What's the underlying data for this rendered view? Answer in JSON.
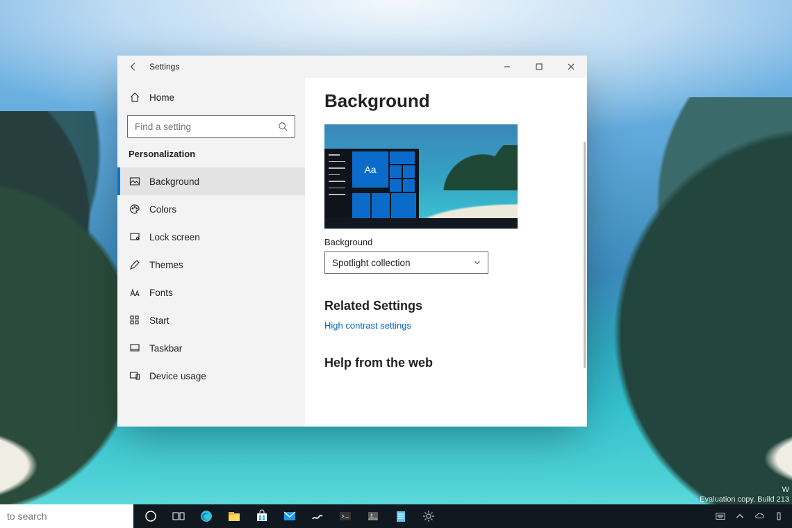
{
  "window": {
    "title": "Settings",
    "header": "Background",
    "search_placeholder": "Find a setting",
    "section": "Personalization",
    "home_label": "Home",
    "background_label": "Background",
    "dropdown_value": "Spotlight collection",
    "related_header": "Related Settings",
    "related_link": "High contrast settings",
    "help_header": "Help from the web",
    "nav": [
      {
        "label": "Background"
      },
      {
        "label": "Colors"
      },
      {
        "label": "Lock screen"
      },
      {
        "label": "Themes"
      },
      {
        "label": "Fonts"
      },
      {
        "label": "Start"
      },
      {
        "label": "Taskbar"
      },
      {
        "label": "Device usage"
      }
    ],
    "preview_tile_text": "Aa"
  },
  "desktop": {
    "watermark_line1": "W",
    "watermark_line2": "Evaluation copy. Build 213"
  },
  "taskbar": {
    "search_placeholder": "to search"
  }
}
